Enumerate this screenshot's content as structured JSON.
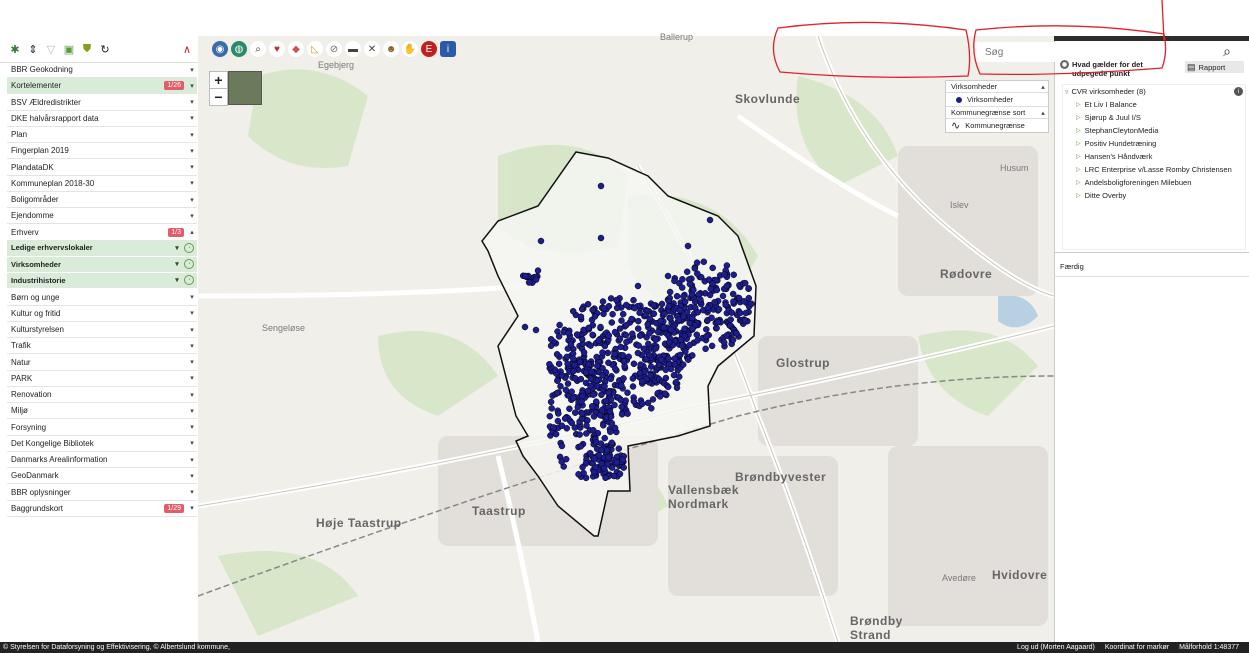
{
  "toolbar_left": {
    "icons": [
      "settings-icon",
      "sort-icon",
      "filter-icon",
      "add-layer-icon",
      "shield-icon",
      "refresh-icon",
      "collapse-icon"
    ]
  },
  "layers": [
    {
      "label": "BBR Geokodning",
      "badge": "",
      "arrow": "▾",
      "hl": false,
      "sub": false
    },
    {
      "label": "Kortelementer",
      "badge": "1/26",
      "arrow": "▾",
      "hl": true,
      "sub": false
    },
    {
      "label": "BSV Ældredistrikter",
      "badge": "",
      "arrow": "▾",
      "hl": false,
      "sub": false
    },
    {
      "label": "DKE halvårsrapport data",
      "badge": "",
      "arrow": "▾",
      "hl": false,
      "sub": false
    },
    {
      "label": "Plan",
      "badge": "",
      "arrow": "▾",
      "hl": false,
      "sub": false
    },
    {
      "label": "Fingerplan 2019",
      "badge": "",
      "arrow": "▾",
      "hl": false,
      "sub": false
    },
    {
      "label": "PlandataDK",
      "badge": "",
      "arrow": "▾",
      "hl": false,
      "sub": false
    },
    {
      "label": "Kommuneplan 2018-30",
      "badge": "",
      "arrow": "▾",
      "hl": false,
      "sub": false
    },
    {
      "label": "Boligområder",
      "badge": "",
      "arrow": "▾",
      "hl": false,
      "sub": false
    },
    {
      "label": "Ejendomme",
      "badge": "",
      "arrow": "▾",
      "hl": false,
      "sub": false
    },
    {
      "label": "Erhverv",
      "badge": "1/3",
      "arrow": "▴",
      "hl": false,
      "sub": false
    },
    {
      "label": "Ledige erhvervslokaler",
      "badge": "",
      "arrow": "▾",
      "hl": true,
      "sub": true
    },
    {
      "label": "Virksomheder",
      "badge": "",
      "arrow": "▾",
      "hl": true,
      "sub": true
    },
    {
      "label": "Industrihistorie",
      "badge": "",
      "arrow": "▾",
      "hl": true,
      "sub": true
    },
    {
      "label": "Børn og unge",
      "badge": "",
      "arrow": "▾",
      "hl": false,
      "sub": false
    },
    {
      "label": "Kultur og fritid",
      "badge": "",
      "arrow": "▾",
      "hl": false,
      "sub": false
    },
    {
      "label": "Kulturstyrelsen",
      "badge": "",
      "arrow": "▾",
      "hl": false,
      "sub": false
    },
    {
      "label": "Trafik",
      "badge": "",
      "arrow": "▾",
      "hl": false,
      "sub": false
    },
    {
      "label": "Natur",
      "badge": "",
      "arrow": "▾",
      "hl": false,
      "sub": false
    },
    {
      "label": "PARK",
      "badge": "",
      "arrow": "▾",
      "hl": false,
      "sub": false
    },
    {
      "label": "Renovation",
      "badge": "",
      "arrow": "▾",
      "hl": false,
      "sub": false
    },
    {
      "label": "Miljø",
      "badge": "",
      "arrow": "▾",
      "hl": false,
      "sub": false
    },
    {
      "label": "Forsyning",
      "badge": "",
      "arrow": "▾",
      "hl": false,
      "sub": false
    },
    {
      "label": "Det Kongelige Bibliotek",
      "badge": "",
      "arrow": "▾",
      "hl": false,
      "sub": false
    },
    {
      "label": "Danmarks Arealinformation",
      "badge": "",
      "arrow": "▾",
      "hl": false,
      "sub": false
    },
    {
      "label": "GeoDanmark",
      "badge": "",
      "arrow": "▾",
      "hl": false,
      "sub": false
    },
    {
      "label": "BBR oplysninger",
      "badge": "",
      "arrow": "▾",
      "hl": false,
      "sub": false
    },
    {
      "label": "Baggrundskort",
      "badge": "1/29",
      "arrow": "▾",
      "hl": false,
      "sub": false
    }
  ],
  "map_tools": [
    "layers-icon",
    "globe-icon",
    "zoom-icon",
    "heart-icon",
    "eraser-icon",
    "measure-icon",
    "link-icon",
    "car-icon",
    "tools-icon",
    "person-icon",
    "hand-icon",
    "e-icon",
    "info-icon"
  ],
  "zoom": {
    "plus": "+",
    "minus": "−"
  },
  "places": [
    {
      "name": "Ballerup",
      "big": false
    },
    {
      "name": "Skovlunde",
      "big": true
    },
    {
      "name": "Rødovre",
      "big": true
    },
    {
      "name": "Glostrup",
      "big": true
    },
    {
      "name": "Brøndbyvester",
      "big": true
    },
    {
      "name": "Taastrup",
      "big": true
    },
    {
      "name": "Høje Taastrup",
      "big": true
    },
    {
      "name": "Vallensbæk Nordmark",
      "big": true
    },
    {
      "name": "Brøndby Strand",
      "big": true
    },
    {
      "name": "Hvidovre",
      "big": true
    },
    {
      "name": "Sengeløse",
      "big": false
    },
    {
      "name": "Husum",
      "big": false
    },
    {
      "name": "Islev",
      "big": false
    },
    {
      "name": "Avedøre",
      "big": false
    },
    {
      "name": "Egebjerg",
      "big": false
    }
  ],
  "legend": {
    "virksomheder_header": "Virksomheder",
    "virksomheder_item": "Virksomheder",
    "kommune_header": "Kommunegrænse sort",
    "kommune_item": "Kommunegrænse"
  },
  "search": {
    "placeholder": "Søg"
  },
  "info": {
    "text": "Hvad gælder for det udpegede punkt"
  },
  "rapport": {
    "label": "Rapport"
  },
  "cvr": {
    "header": "CVR virksomheder (8)",
    "items": [
      "Et Liv I Balance",
      "Sjørup & Juul I/S",
      "StephanCleytonMedia",
      "Positiv Hundetræning",
      "Hansen's Håndværk",
      "LRC Enterprise v/Lasse Romby Christensen",
      "Andelsboligforeningen Milebuen",
      "Ditte Overby"
    ]
  },
  "faerdig": "Færdig",
  "status": {
    "left": "© Styrelsen for Dataforsyning og Effektivisering, © Albertslund kommune,",
    "logout": "Log ud (Morten Aagaard)",
    "coord": "Koordinat for markør",
    "scale": "Målforhold 1:48377"
  },
  "colors": {
    "accent_green": "#d8ecd8",
    "badge_red": "#e25c6a",
    "point_blue": "#1d1d8f",
    "annotation_red": "#e0202a"
  }
}
